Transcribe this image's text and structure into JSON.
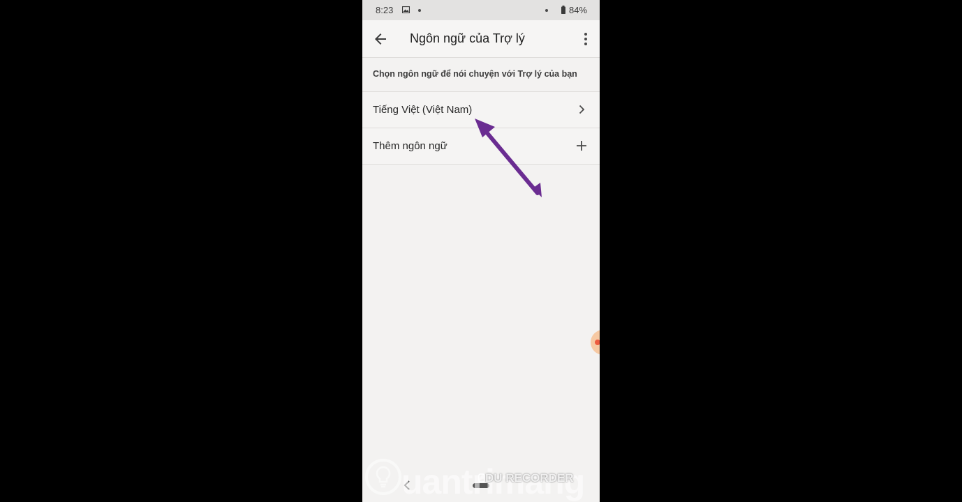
{
  "status_bar": {
    "time": "8:23",
    "battery": "84%"
  },
  "app_bar": {
    "title": "Ngôn ngữ của Trợ lý"
  },
  "section_header": "Chọn ngôn ngữ để nói chuyện với Trợ lý của bạn",
  "languages": [
    {
      "label": "Tiếng Việt (Việt Nam)",
      "icon": "chevron-right-icon"
    },
    {
      "label": "Thêm ngôn ngữ",
      "icon": "plus-icon"
    }
  ],
  "watermark": {
    "brand": "uantrimang",
    "recorder": "DU RECORDER"
  },
  "colors": {
    "arrow": "#6a2c91",
    "background": "#f3f2f1",
    "status_bar": "#e3e2e1",
    "bubble": "#f6c9a3",
    "bubble_dot": "#ec5b3f"
  }
}
